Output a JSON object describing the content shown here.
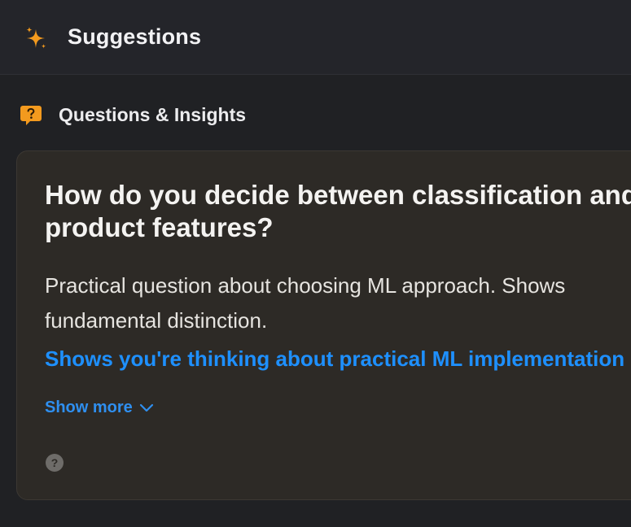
{
  "header": {
    "icon": "sparkle-icon",
    "title": "Suggestions"
  },
  "section": {
    "icon": "question-bubble-icon",
    "label": "Questions & Insights"
  },
  "card": {
    "question": "How do you decide between classification and\nproduct features?",
    "description": "Practical question about choosing ML approach. Shows\nfundamental distinction.",
    "insight": "Shows you're thinking about practical ML implementation",
    "show_more_label": "Show more",
    "show_more_icon": "chevron-down-icon",
    "help_icon": "help-icon",
    "help_glyph": "?"
  },
  "colors": {
    "accent_orange": "#f39a1e",
    "link_blue": "#1e90ff",
    "card_bg": "#2d2a26",
    "page_bg": "#202124"
  }
}
